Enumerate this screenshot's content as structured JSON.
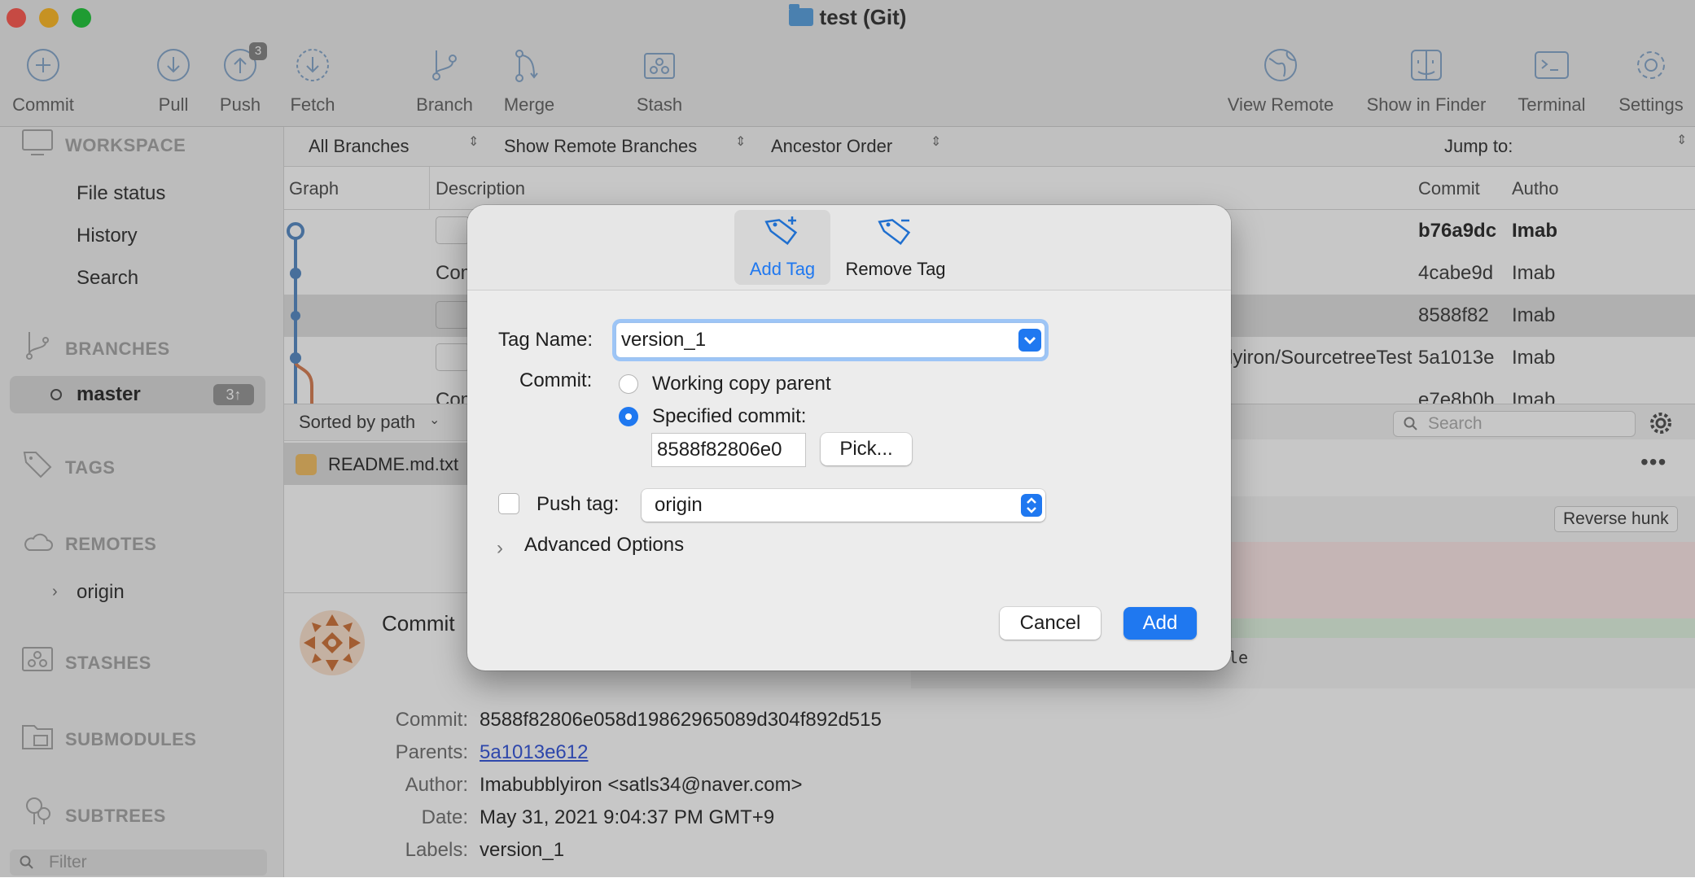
{
  "window": {
    "title": "test (Git)"
  },
  "toolbar": {
    "commit": "Commit",
    "pull": "Pull",
    "push": "Push",
    "push_badge": "3",
    "fetch": "Fetch",
    "branch": "Branch",
    "merge": "Merge",
    "stash": "Stash",
    "view_remote": "View Remote",
    "show_in_finder": "Show in Finder",
    "terminal": "Terminal",
    "settings": "Settings"
  },
  "sidebar": {
    "workspace": "WORKSPACE",
    "workspace_items": [
      "File status",
      "History",
      "Search"
    ],
    "branches": "BRANCHES",
    "branch_item": "master",
    "branch_badge": "3↑",
    "tags": "TAGS",
    "remotes": "REMOTES",
    "remote_item": "origin",
    "stashes": "STASHES",
    "submodules": "SUBMODULES",
    "subtrees": "SUBTREES",
    "filter_placeholder": "Filter"
  },
  "filterbar": {
    "branches": "All Branches",
    "remote": "Show Remote Branches",
    "order": "Ancestor Order",
    "jump": "Jump to:"
  },
  "columns": {
    "graph": "Graph",
    "description": "Description",
    "commit": "Commit",
    "author": "Autho"
  },
  "commits": [
    {
      "desc": "",
      "hash": "b76a9dc",
      "author": "Imab"
    },
    {
      "desc": "Com",
      "hash": "4cabe9d",
      "author": "Imab"
    },
    {
      "desc": "",
      "hash": "8588f82",
      "author": "Imab"
    },
    {
      "desc": "lyiron/SourcetreeTest",
      "hash": "5a1013e",
      "author": "Imab"
    },
    {
      "desc": "Com",
      "hash": "e7e8b0b",
      "author": "Imab"
    }
  ],
  "files": {
    "sort": "Sorted by path",
    "file": "README.md.txt"
  },
  "diff": {
    "search_placeholder": "Search",
    "reverse": "Reverse hunk",
    "snippet": "le"
  },
  "details": {
    "header": "Commit",
    "commit_label": "Commit:",
    "commit_value": "8588f82806e058d19862965089d304f892d515",
    "parents_label": "Parents:",
    "parents_value": "5a1013e612",
    "author_label": "Author:",
    "author_value": "Imabubblyiron <satls34@naver.com>",
    "date_label": "Date:",
    "date_value": "May 31, 2021 9:04:37 PM GMT+9",
    "labels_label": "Labels:",
    "labels_value": "version_1"
  },
  "dialog": {
    "tab_add": "Add Tag",
    "tab_remove": "Remove Tag",
    "tag_name_label": "Tag Name:",
    "tag_name_value": "version_1",
    "commit_label": "Commit:",
    "opt_working": "Working copy parent",
    "opt_specified": "Specified commit:",
    "commit_value": "8588f82806e0",
    "pick": "Pick...",
    "push_label": "Push tag:",
    "remote": "origin",
    "advanced": "Advanced Options",
    "cancel": "Cancel",
    "add": "Add"
  },
  "colors": {
    "accent": "#1f78f0",
    "graph": "#5d8fc7"
  }
}
